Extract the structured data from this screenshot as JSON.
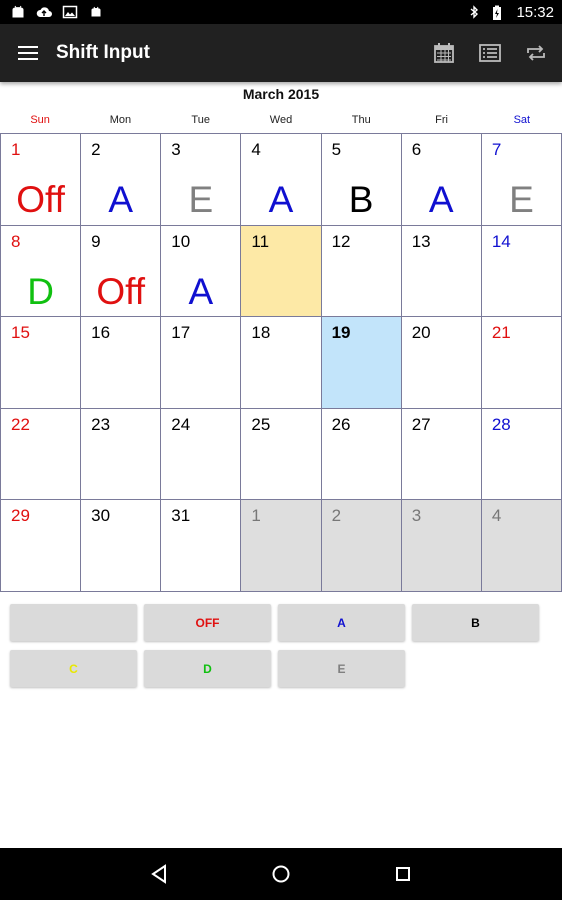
{
  "status_bar": {
    "time": "15:32",
    "battery_level": "charging",
    "left_icons": [
      "android-icon",
      "cloud-upload-icon",
      "image-icon",
      "android-debug-icon"
    ],
    "right_icons": [
      "bluetooth-icon",
      "battery-icon"
    ]
  },
  "app_bar": {
    "title": "Shift Input",
    "actions": [
      "calendar-icon",
      "list-icon",
      "repeat-icon"
    ]
  },
  "calendar": {
    "month_title": "March 2015",
    "weekdays": [
      {
        "label": "Sun",
        "color": "#e01010"
      },
      {
        "label": "Mon",
        "color": "#222222"
      },
      {
        "label": "Tue",
        "color": "#222222"
      },
      {
        "label": "Wed",
        "color": "#222222"
      },
      {
        "label": "Thu",
        "color": "#222222"
      },
      {
        "label": "Fri",
        "color": "#222222"
      },
      {
        "label": "Sat",
        "color": "#1010d0"
      }
    ],
    "weeks": [
      [
        {
          "day": "1",
          "shift": "Off",
          "shift_color": "#e01010",
          "day_color": "#e01010"
        },
        {
          "day": "2",
          "shift": "A",
          "shift_color": "#1010d0"
        },
        {
          "day": "3",
          "shift": "E",
          "shift_color": "#808080"
        },
        {
          "day": "4",
          "shift": "A",
          "shift_color": "#1010d0"
        },
        {
          "day": "5",
          "shift": "B",
          "shift_color": "#000000"
        },
        {
          "day": "6",
          "shift": "A",
          "shift_color": "#1010d0"
        },
        {
          "day": "7",
          "shift": "E",
          "shift_color": "#808080",
          "day_color": "#1010d0"
        }
      ],
      [
        {
          "day": "8",
          "shift": "D",
          "shift_color": "#10c010",
          "day_color": "#e01010"
        },
        {
          "day": "9",
          "shift": "Off",
          "shift_color": "#e01010"
        },
        {
          "day": "10",
          "shift": "A",
          "shift_color": "#1010d0"
        },
        {
          "day": "11",
          "state": "selected"
        },
        {
          "day": "12"
        },
        {
          "day": "13"
        },
        {
          "day": "14",
          "day_color": "#1010d0"
        }
      ],
      [
        {
          "day": "15",
          "day_color": "#e01010"
        },
        {
          "day": "16"
        },
        {
          "day": "17"
        },
        {
          "day": "18"
        },
        {
          "day": "19",
          "state": "today"
        },
        {
          "day": "20"
        },
        {
          "day": "21",
          "day_color": "#e01010"
        }
      ],
      [
        {
          "day": "22",
          "day_color": "#e01010"
        },
        {
          "day": "23"
        },
        {
          "day": "24"
        },
        {
          "day": "25"
        },
        {
          "day": "26"
        },
        {
          "day": "27"
        },
        {
          "day": "28",
          "day_color": "#1010d0"
        }
      ],
      [
        {
          "day": "29",
          "day_color": "#e01010"
        },
        {
          "day": "30"
        },
        {
          "day": "31"
        },
        {
          "day": "1",
          "state": "other"
        },
        {
          "day": "2",
          "state": "other"
        },
        {
          "day": "3",
          "state": "other"
        },
        {
          "day": "4",
          "state": "other"
        }
      ]
    ]
  },
  "shift_buttons": [
    [
      {
        "label": "",
        "color": "#000000"
      },
      {
        "label": "OFF",
        "color": "#e01010"
      },
      {
        "label": "A",
        "color": "#1010d0"
      },
      {
        "label": "B",
        "color": "#000000"
      }
    ],
    [
      {
        "label": "C",
        "color": "#e8e800"
      },
      {
        "label": "D",
        "color": "#10c010"
      },
      {
        "label": "E",
        "color": "#808080"
      }
    ]
  ],
  "nav_bar": {
    "buttons": [
      "back-icon",
      "home-icon",
      "recents-icon"
    ]
  }
}
